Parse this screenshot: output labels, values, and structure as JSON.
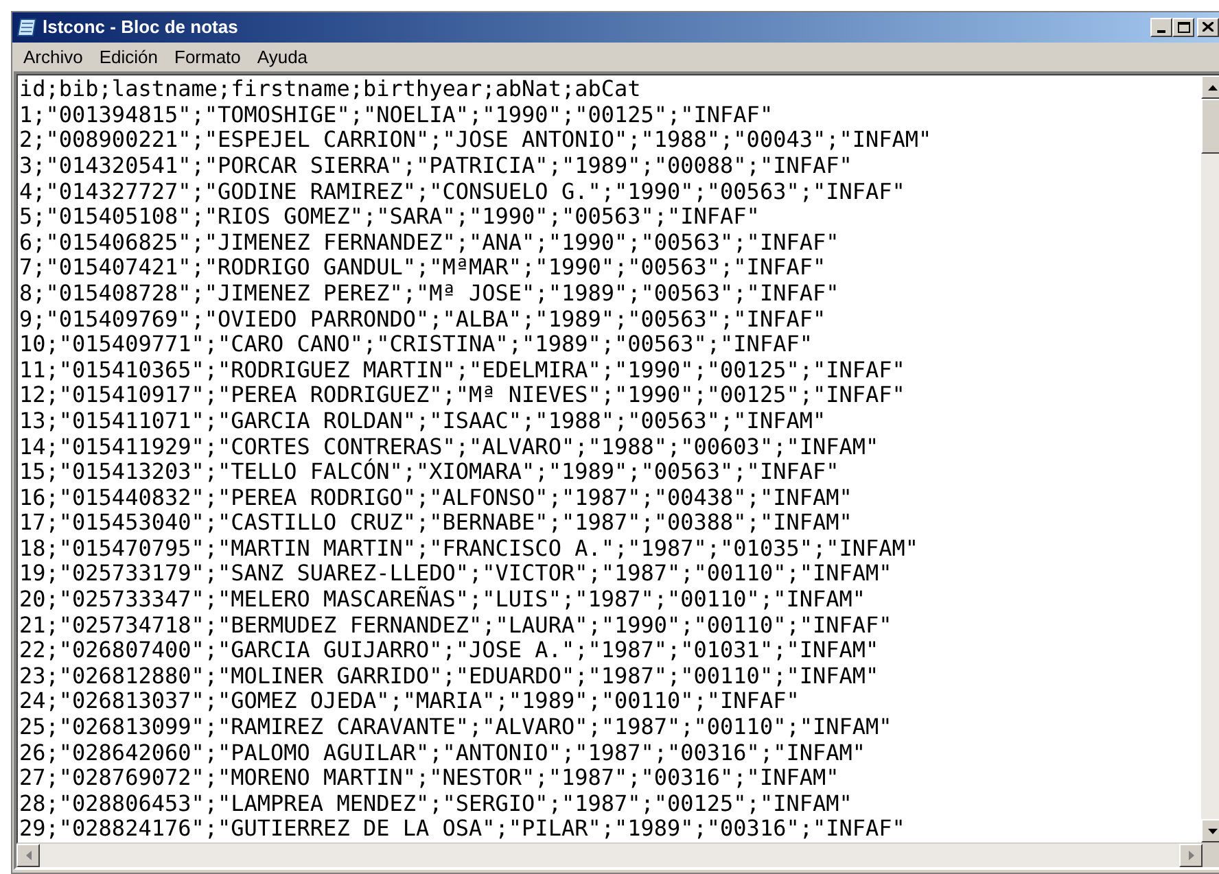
{
  "window": {
    "title": "lstconc - Bloc de notas"
  },
  "menu": [
    "Archivo",
    "Edición",
    "Formato",
    "Ayuda"
  ],
  "editor": {
    "lines": [
      "id;bib;lastname;firstname;birthyear;abNat;abCat",
      "1;\"001394815\";\"TOMOSHIGE\";\"NOELIA\";\"1990\";\"00125\";\"INFAF\"",
      "2;\"008900221\";\"ESPEJEL CARRION\";\"JOSE ANTONIO\";\"1988\";\"00043\";\"INFAM\"",
      "3;\"014320541\";\"PORCAR SIERRA\";\"PATRICIA\";\"1989\";\"00088\";\"INFAF\"",
      "4;\"014327727\";\"GODINE RAMIREZ\";\"CONSUELO G.\";\"1990\";\"00563\";\"INFAF\"",
      "5;\"015405108\";\"RIOS GOMEZ\";\"SARA\";\"1990\";\"00563\";\"INFAF\"",
      "6;\"015406825\";\"JIMENEZ FERNANDEZ\";\"ANA\";\"1990\";\"00563\";\"INFAF\"",
      "7;\"015407421\";\"RODRIGO GANDUL\";\"MªMAR\";\"1990\";\"00563\";\"INFAF\"",
      "8;\"015408728\";\"JIMENEZ PEREZ\";\"Mª JOSE\";\"1989\";\"00563\";\"INFAF\"",
      "9;\"015409769\";\"OVIEDO PARRONDO\";\"ALBA\";\"1989\";\"00563\";\"INFAF\"",
      "10;\"015409771\";\"CARO CANO\";\"CRISTINA\";\"1989\";\"00563\";\"INFAF\"",
      "11;\"015410365\";\"RODRIGUEZ MARTIN\";\"EDELMIRA\";\"1990\";\"00125\";\"INFAF\"",
      "12;\"015410917\";\"PEREA RODRIGUEZ\";\"Mª NIEVES\";\"1990\";\"00125\";\"INFAF\"",
      "13;\"015411071\";\"GARCIA ROLDAN\";\"ISAAC\";\"1988\";\"00563\";\"INFAM\"",
      "14;\"015411929\";\"CORTES CONTRERAS\";\"ALVARO\";\"1988\";\"00603\";\"INFAM\"",
      "15;\"015413203\";\"TELLO FALCÓN\";\"XIOMARA\";\"1989\";\"00563\";\"INFAF\"",
      "16;\"015440832\";\"PEREA RODRIGO\";\"ALFONSO\";\"1987\";\"00438\";\"INFAM\"",
      "17;\"015453040\";\"CASTILLO CRUZ\";\"BERNABE\";\"1987\";\"00388\";\"INFAM\"",
      "18;\"015470795\";\"MARTIN MARTIN\";\"FRANCISCO A.\";\"1987\";\"01035\";\"INFAM\"",
      "19;\"025733179\";\"SANZ SUAREZ-LLEDO\";\"VICTOR\";\"1987\";\"00110\";\"INFAM\"",
      "20;\"025733347\";\"MELERO MASCAREÑAS\";\"LUIS\";\"1987\";\"00110\";\"INFAM\"",
      "21;\"025734718\";\"BERMUDEZ FERNANDEZ\";\"LAURA\";\"1990\";\"00110\";\"INFAF\"",
      "22;\"026807400\";\"GARCIA GUIJARRO\";\"JOSE A.\";\"1987\";\"01031\";\"INFAM\"",
      "23;\"026812880\";\"MOLINER GARRIDO\";\"EDUARDO\";\"1987\";\"00110\";\"INFAM\"",
      "24;\"026813037\";\"GOMEZ OJEDA\";\"MARIA\";\"1989\";\"00110\";\"INFAF\"",
      "25;\"026813099\";\"RAMIREZ CARAVANTE\";\"ALVARO\";\"1987\";\"00110\";\"INFAM\"",
      "26;\"028642060\";\"PALOMO AGUILAR\";\"ANTONIO\";\"1987\";\"00316\";\"INFAM\"",
      "27;\"028769072\";\"MORENO MARTIN\";\"NESTOR\";\"1987\";\"00316\";\"INFAM\"",
      "28;\"028806453\";\"LAMPREA MENDEZ\";\"SERGIO\";\"1987\";\"00125\";\"INFAM\"",
      "29;\"028824176\";\"GUTIERREZ DE LA OSA\";\"PILAR\";\"1989\";\"00316\";\"INFAF\""
    ]
  }
}
